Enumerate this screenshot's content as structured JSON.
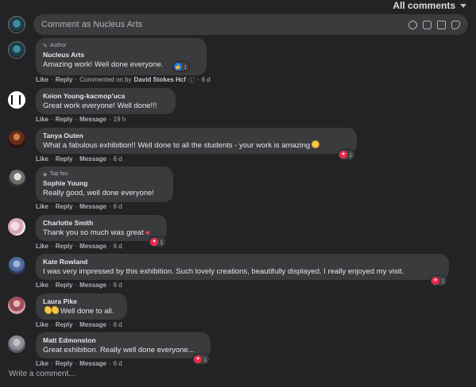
{
  "header": {
    "filter_label": "All comments"
  },
  "composer": {
    "placeholder": "Comment as Nucleus Arts"
  },
  "comments": [
    {
      "badge": "Author",
      "name": "Nucleus Arts",
      "text": "Amazing work! Well done everyone.",
      "actions": {
        "like": "Like",
        "reply": "Reply",
        "meta_prefix": "Commented on by",
        "meta_name": "David Stokes Hcf",
        "time": "6 d"
      },
      "reaction": {
        "type": "like",
        "count": "1"
      }
    },
    {
      "name": "Keion Young-kacmop'uca",
      "text": "Great work everyone! Well done!!!",
      "actions": {
        "like": "Like",
        "reply": "Reply",
        "message": "Message",
        "time": "19 h"
      }
    },
    {
      "name": "Tanya Outen",
      "text": "What a fabulous exhibition!! Well done to all the students - your work is amazing",
      "emoji": "star-eyes",
      "actions": {
        "like": "Like",
        "reply": "Reply",
        "message": "Message",
        "time": "6 d"
      },
      "reaction": {
        "type": "love",
        "count": "1"
      }
    },
    {
      "badge": "Top fan",
      "name": "Sophie Young",
      "text": "Really good, well done everyone!",
      "actions": {
        "like": "Like",
        "reply": "Reply",
        "message": "Message",
        "time": "6 d"
      }
    },
    {
      "name": "Charlotte Smith",
      "text": "Thank you so much was great",
      "emoji": "red-heart",
      "actions": {
        "like": "Like",
        "reply": "Reply",
        "message": "Message",
        "time": "6 d"
      },
      "reaction": {
        "type": "love",
        "count": "1"
      }
    },
    {
      "name": "Kate Rowland",
      "text": "I was very impressed by this exhibition. Such lovely creations, beautifully displayed. I really enjoyed my visit.",
      "actions": {
        "like": "Like",
        "reply": "Reply",
        "message": "Message",
        "time": "6 d"
      },
      "reaction": {
        "type": "love",
        "count": "1"
      }
    },
    {
      "name": "Laura Pike",
      "text": "Well done to all.",
      "emoji": "clapping-hands",
      "actions": {
        "like": "Like",
        "reply": "Reply",
        "message": "Message",
        "time": "6 d"
      }
    },
    {
      "name": "Matt Edmonston",
      "text": "Great exhibition. Really well done everyone...",
      "actions": {
        "like": "Like",
        "reply": "Reply",
        "message": "Message",
        "time": "6 d"
      },
      "reaction": {
        "type": "love",
        "count": "1"
      }
    }
  ],
  "footer": {
    "write_placeholder": "Write a comment..."
  },
  "colors": {
    "background": "#232325",
    "bubble": "#3a3b3d",
    "text": "#e4e6eb",
    "muted": "#b0b3b8",
    "love": "#f0284a",
    "like": "#1877f2"
  }
}
